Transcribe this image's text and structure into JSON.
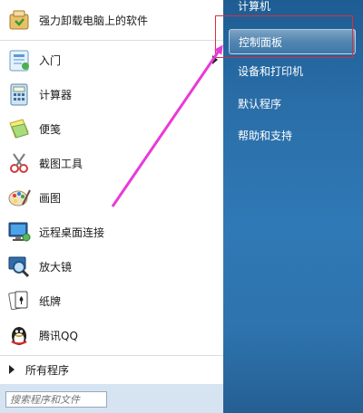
{
  "programs": [
    {
      "label": "强力卸载电脑上的软件",
      "icon": "uninstaller-icon"
    },
    {
      "label": "入门",
      "icon": "getting-started-icon",
      "has_submenu": true
    },
    {
      "label": "计算器",
      "icon": "calculator-icon"
    },
    {
      "label": "便笺",
      "icon": "sticky-notes-icon"
    },
    {
      "label": "截图工具",
      "icon": "snipping-tool-icon"
    },
    {
      "label": "画图",
      "icon": "paint-icon"
    },
    {
      "label": "远程桌面连接",
      "icon": "remote-desktop-icon"
    },
    {
      "label": "放大镜",
      "icon": "magnifier-icon"
    },
    {
      "label": "纸牌",
      "icon": "solitaire-icon"
    },
    {
      "label": "腾讯QQ",
      "icon": "qq-icon"
    }
  ],
  "all_programs_label": "所有程序",
  "search": {
    "placeholder": "搜索程序和文件",
    "value": ""
  },
  "right_menu": [
    {
      "label": "计算机"
    },
    {
      "label": "控制面板",
      "highlighted": true
    },
    {
      "label": "设备和打印机"
    },
    {
      "label": "默认程序"
    },
    {
      "label": "帮助和支持"
    }
  ],
  "colors": {
    "right_pane": "#2f79b6",
    "annotation_arrow": "#e83ad8",
    "annotation_box": "#e12a3a"
  }
}
